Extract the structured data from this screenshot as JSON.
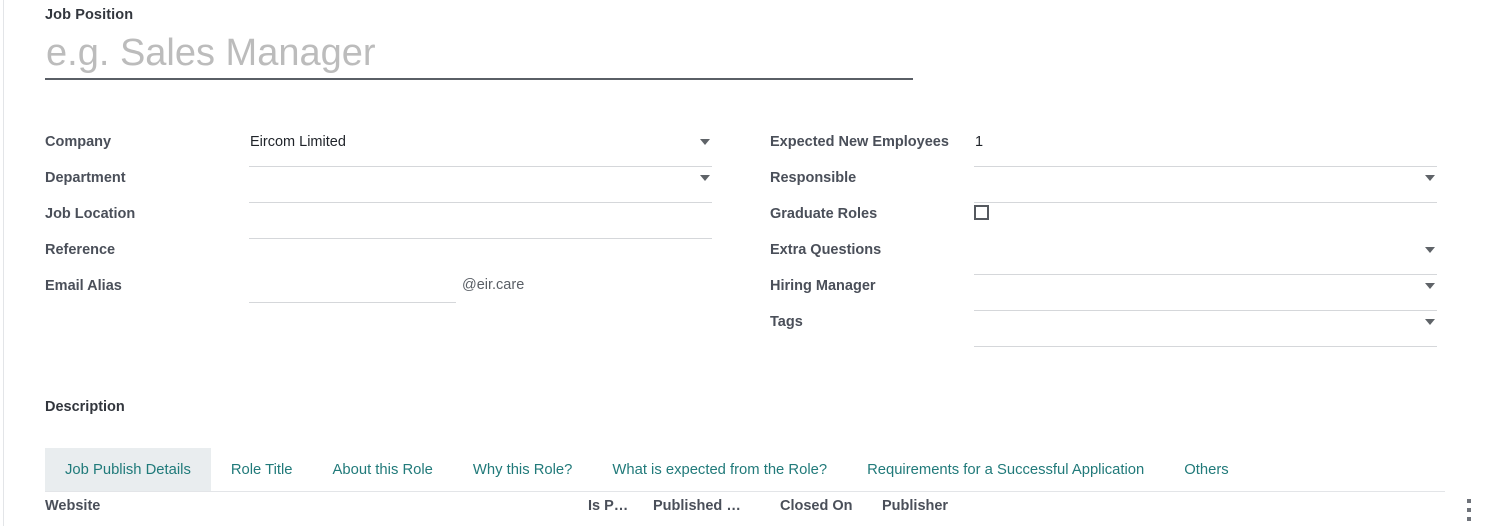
{
  "form": {
    "title_label": "Job Position",
    "title_placeholder": "e.g. Sales Manager",
    "title_value": "",
    "left_fields": [
      {
        "label": "Company",
        "value": "Eircom Limited",
        "control": "dropdown"
      },
      {
        "label": "Department",
        "value": "",
        "control": "dropdown"
      },
      {
        "label": "Job Location",
        "value": "",
        "control": "text"
      },
      {
        "label": "Reference",
        "value": "",
        "control": "plain"
      },
      {
        "label": "Email Alias",
        "value": "",
        "control": "alias",
        "suffix": "@eir.care"
      }
    ],
    "right_fields": [
      {
        "label": "Expected New Employees",
        "value": "1",
        "control": "text"
      },
      {
        "label": "Responsible",
        "value": "",
        "control": "dropdown"
      },
      {
        "label": "Graduate Roles",
        "value": "",
        "control": "checkbox",
        "checked": false
      },
      {
        "label": "Extra Questions",
        "value": "",
        "control": "dropdown"
      },
      {
        "label": "Hiring Manager",
        "value": "",
        "control": "dropdown"
      },
      {
        "label": "Tags",
        "value": "",
        "control": "dropdown"
      }
    ]
  },
  "description": {
    "label": "Description",
    "tabs": [
      {
        "label": "Job Publish Details",
        "active": true
      },
      {
        "label": "Role Title",
        "active": false
      },
      {
        "label": "About this Role",
        "active": false
      },
      {
        "label": "Why this Role?",
        "active": false
      },
      {
        "label": "What is expected from the Role?",
        "active": false
      },
      {
        "label": "Requirements for a Successful Application",
        "active": false
      },
      {
        "label": "Others",
        "active": false
      }
    ]
  },
  "list": {
    "columns": [
      {
        "key": "website",
        "label": "Website"
      },
      {
        "key": "ispub",
        "label": "Is P…"
      },
      {
        "key": "published",
        "label": "Published …"
      },
      {
        "key": "closed",
        "label": "Closed On"
      },
      {
        "key": "publisher",
        "label": "Publisher"
      }
    ],
    "rows": [],
    "options_icon": "kebab-menu-icon"
  },
  "colors": {
    "accent_teal": "#217a7a",
    "active_tab_bg": "#e9edef",
    "label_gray": "#4a4f59",
    "underline": "#d5d7da",
    "title_underline": "#5a5f66"
  }
}
